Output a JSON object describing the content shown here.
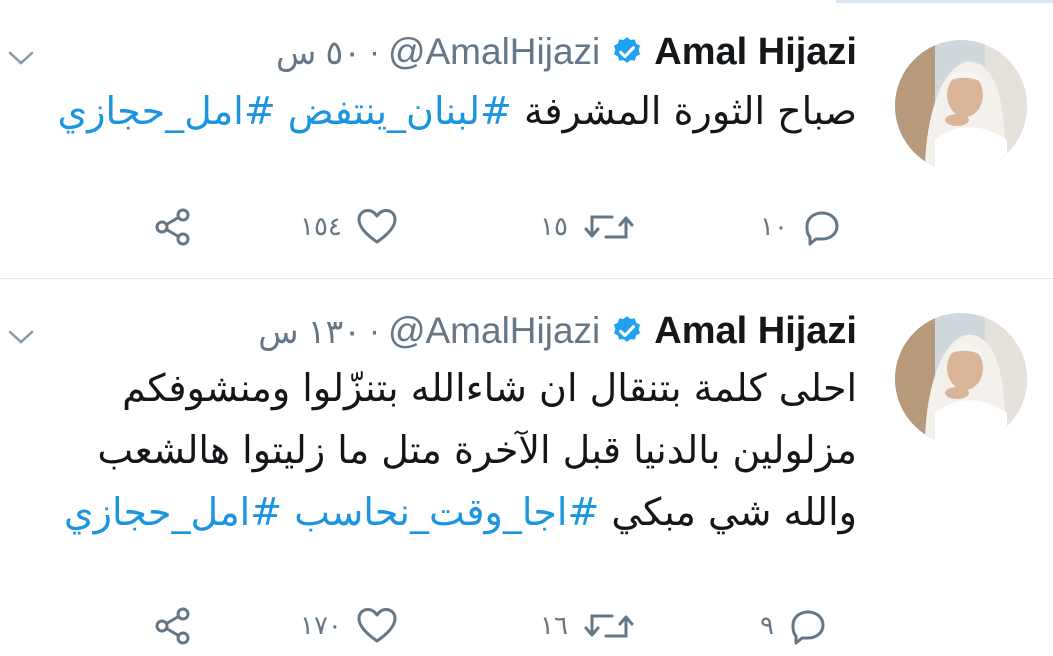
{
  "tweets": [
    {
      "author": {
        "name": "Amal Hijazi",
        "handle": "@AmalHijazi",
        "verified": true
      },
      "time": "٥٠ س",
      "separator": "·",
      "text": {
        "plain": "صباح الثورة المشرفة",
        "hashtags": [
          "#لبنان_ينتفض",
          "#امل_حجازي"
        ]
      },
      "actions": {
        "replies": "١٠",
        "retweets": "١٥",
        "likes": "١٥٤"
      }
    },
    {
      "author": {
        "name": "Amal Hijazi",
        "handle": "@AmalHijazi",
        "verified": true
      },
      "time": "١٣٠ س",
      "separator": "·",
      "text": {
        "plain": "احلى كلمة بتنقال ان شاءالله بتنزّلوا ومنشوفكم مزلولين بالدنيا قبل الآخرة متل ما زليتوا هالشعب والله شي مبكي",
        "hashtags": [
          "#اجا_وقت_نحاسب",
          "#امل_حجازي"
        ]
      },
      "actions": {
        "replies": "٩",
        "retweets": "١٦",
        "likes": "١٧٠"
      }
    }
  ],
  "icons": {
    "reply": "reply-icon",
    "retweet": "retweet-icon",
    "like": "like-icon",
    "share": "share-icon",
    "verified": "verified-badge-icon",
    "menu": "chevron-down-icon"
  },
  "colors": {
    "link": "#1b95e0",
    "secondary": "#657786",
    "text": "#14171a",
    "divider": "#e1e8ed",
    "verified": "#1da1f2"
  }
}
